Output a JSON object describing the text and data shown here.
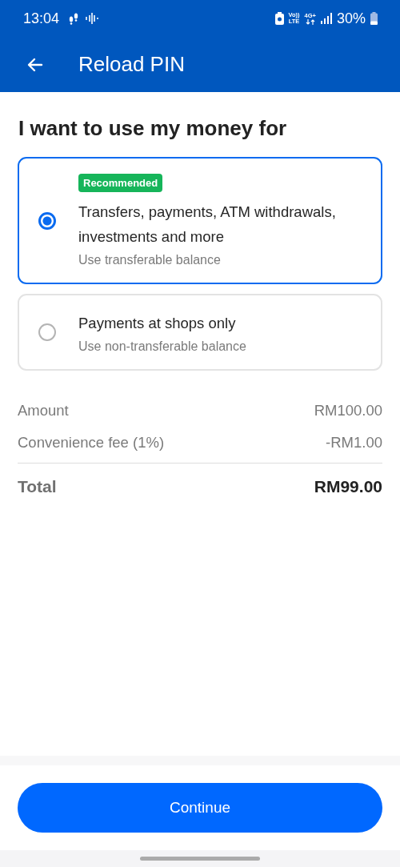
{
  "status_bar": {
    "time": "13:04",
    "volte": "Vo))",
    "lte": "LTE",
    "network": "4G+",
    "battery": "30%"
  },
  "app_bar": {
    "title": "Reload PIN"
  },
  "heading": "I want to use my money for",
  "options": [
    {
      "badge": "Recommended",
      "title": "Transfers, payments, ATM withdrawals, investments and more",
      "subtitle": "Use transferable balance",
      "selected": true
    },
    {
      "title": "Payments at shops only",
      "subtitle": "Use non-transferable balance",
      "selected": false
    }
  ],
  "summary": [
    {
      "label": "Amount",
      "value": "RM100.00"
    },
    {
      "label": "Convenience fee (1%)",
      "value": "-RM1.00"
    }
  ],
  "total": {
    "label": "Total",
    "value": "RM99.00"
  },
  "button": "Continue"
}
